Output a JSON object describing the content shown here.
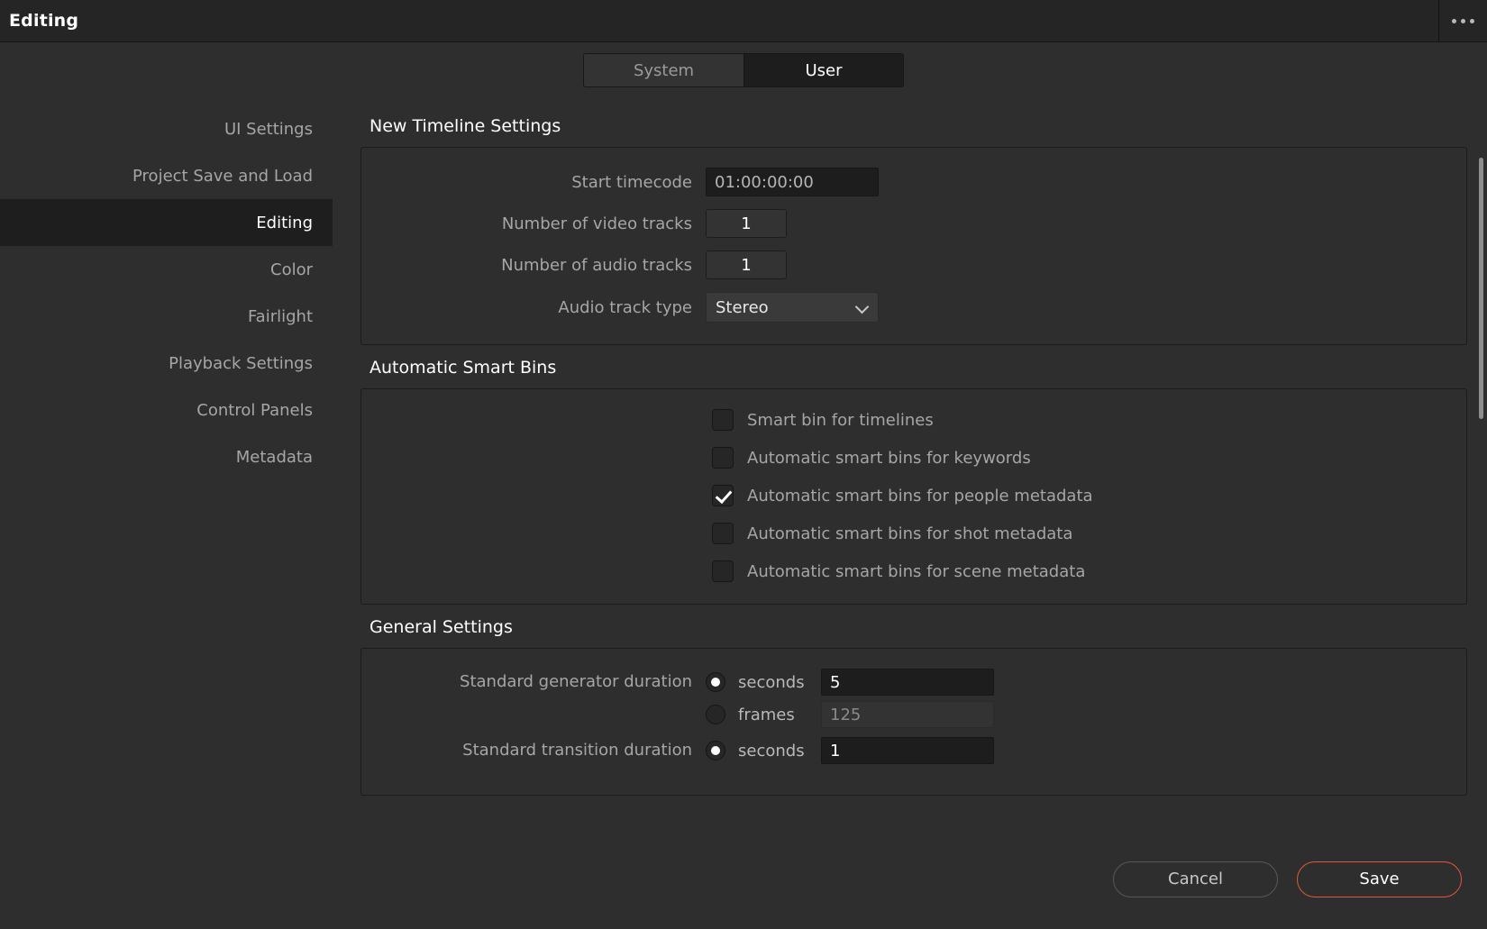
{
  "titlebar": {
    "title": "Editing",
    "menu_icon": "more-horizontal-icon"
  },
  "tabs": [
    {
      "label": "System",
      "active": false
    },
    {
      "label": "User",
      "active": true
    }
  ],
  "sidebar": {
    "items": [
      {
        "label": "UI Settings",
        "active": false
      },
      {
        "label": "Project Save and Load",
        "active": false
      },
      {
        "label": "Editing",
        "active": true
      },
      {
        "label": "Color",
        "active": false
      },
      {
        "label": "Fairlight",
        "active": false
      },
      {
        "label": "Playback Settings",
        "active": false
      },
      {
        "label": "Control Panels",
        "active": false
      },
      {
        "label": "Metadata",
        "active": false
      }
    ]
  },
  "sections": {
    "new_timeline": {
      "title": "New Timeline Settings",
      "start_timecode": {
        "label": "Start timecode",
        "value": "01:00:00:00"
      },
      "video_tracks": {
        "label": "Number of video tracks",
        "value": "1"
      },
      "audio_tracks": {
        "label": "Number of audio tracks",
        "value": "1"
      },
      "audio_track_type": {
        "label": "Audio track type",
        "value": "Stereo",
        "icon": "chevron-down-icon"
      }
    },
    "smart_bins": {
      "title": "Automatic Smart Bins",
      "items": [
        {
          "label": "Smart bin for timelines",
          "checked": false
        },
        {
          "label": "Automatic smart bins for keywords",
          "checked": false
        },
        {
          "label": "Automatic smart bins for people metadata",
          "checked": true
        },
        {
          "label": "Automatic smart bins for shot metadata",
          "checked": false
        },
        {
          "label": "Automatic smart bins for scene metadata",
          "checked": false
        }
      ]
    },
    "general": {
      "title": "General Settings",
      "generator_duration": {
        "label": "Standard generator duration",
        "seconds_label": "seconds",
        "seconds_value": "5",
        "seconds_selected": true,
        "frames_label": "frames",
        "frames_value": "125",
        "frames_selected": false
      },
      "transition_duration": {
        "label": "Standard transition duration",
        "seconds_label": "seconds",
        "seconds_value": "1",
        "seconds_selected": true
      }
    }
  },
  "footer": {
    "cancel_label": "Cancel",
    "save_label": "Save",
    "save_accent": "#e2563c"
  }
}
